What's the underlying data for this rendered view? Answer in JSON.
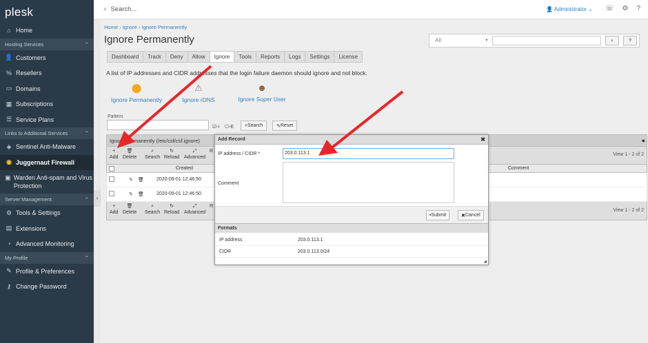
{
  "brand": {
    "logo": "plesk"
  },
  "sidebar": {
    "home": "Home",
    "groups": [
      {
        "label": "Hosting Services",
        "items": [
          {
            "label": "Customers",
            "icon": "user-icon"
          },
          {
            "label": "Resellers",
            "icon": "percent-icon"
          },
          {
            "label": "Domains",
            "icon": "monitor-icon"
          },
          {
            "label": "Subscriptions",
            "icon": "grid-icon"
          },
          {
            "label": "Service Plans",
            "icon": "list-icon"
          }
        ]
      },
      {
        "label": "Links to Additional Services",
        "items": [
          {
            "label": "Sentinel Anti-Malware",
            "icon": "shield-icon"
          },
          {
            "label": "Juggernaut Firewall",
            "icon": "firewall-icon"
          },
          {
            "label": "Warden Anti-spam and Virus Protection",
            "icon": "warden-icon"
          }
        ]
      },
      {
        "label": "Server Management",
        "items": [
          {
            "label": "Tools & Settings",
            "icon": "tools-icon"
          },
          {
            "label": "Extensions",
            "icon": "extensions-icon"
          },
          {
            "label": "Advanced Monitoring",
            "icon": "monitoring-icon"
          }
        ]
      },
      {
        "label": "My Profile",
        "items": [
          {
            "label": "Profile & Preferences",
            "icon": "profile-icon"
          },
          {
            "label": "Change Password",
            "icon": "key-icon"
          }
        ]
      }
    ]
  },
  "topbar": {
    "search_placeholder": "Search...",
    "user": "Administrator"
  },
  "breadcrumb": {
    "home": "Home",
    "ignore": "Ignore",
    "current": "Ignore Permanently"
  },
  "page_title": "Ignore Permanently",
  "top_search": {
    "select_value": "All"
  },
  "tabs": [
    "Dashboard",
    "Track",
    "Deny",
    "Allow",
    "Ignore",
    "Tools",
    "Reports",
    "Logs",
    "Settings",
    "License"
  ],
  "selected_tab": "Ignore",
  "description": "A list of IP addresses and CIDR addresses that the login failure daemon should ignore and not block.",
  "links": {
    "permanent": "Ignore Permanently",
    "rdns": "Ignore rDNS",
    "superuser": "Ignore Super User"
  },
  "filter": {
    "pattern_label": "Pattern",
    "i_label": "-i",
    "e_label": "-E",
    "search": "Search",
    "reset": "Reset"
  },
  "grid": {
    "title": "Ignore Permanently (/etc/csf/csf.ignore)",
    "toolbar": {
      "add": "Add",
      "delete": "Delete",
      "search": "Search",
      "reload": "Reload",
      "advanced": "Advanced",
      "r": "R"
    },
    "page_info": "View 1 - 2 of 2",
    "columns": {
      "created": "Created",
      "comment": "Comment"
    },
    "rows": [
      {
        "created": "2020-09-01 12:46:50"
      },
      {
        "created": "2020-09-01 12:46:50"
      }
    ]
  },
  "dialog": {
    "title": "Add Record",
    "ip_label": "IP address / CIDR",
    "ip_value": "203.0.113.1",
    "comment_label": "Comment",
    "submit": "Submit",
    "cancel": "Cancel",
    "formats_title": "Formats",
    "formats": [
      {
        "name": "IP address",
        "example": "203.0.113.1"
      },
      {
        "name": "CIDR",
        "example": "203.0.113.0/24"
      }
    ]
  },
  "colors": {
    "sidebar": "#2b3a48",
    "link": "#2f7fc0",
    "annotation": "#e8262a"
  }
}
